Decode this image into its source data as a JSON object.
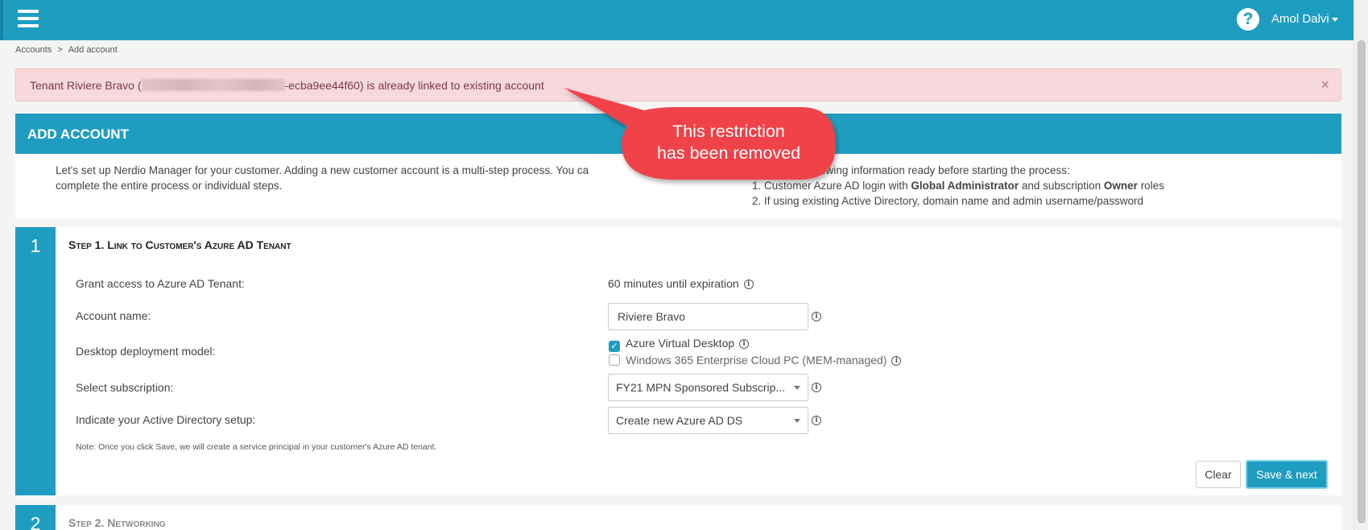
{
  "topbar": {
    "menu_icon": "hamburger-icon",
    "help_icon": "question-circle-icon",
    "help_glyph": "?",
    "user_name": "Amol Dalvi"
  },
  "breadcrumb": {
    "items": [
      "Accounts",
      "Add account"
    ],
    "separator": ">"
  },
  "alert": {
    "text_prefix": "Tenant Riviere Bravo (",
    "text_suffix": "-ecba9ee44f60) is already linked to existing account",
    "close_glyph": "×"
  },
  "card": {
    "title": "ADD ACCOUNT",
    "intro_left": "Let's set up Nerdio Manager for your customer. Adding a new customer account is a multi-step process. You ca... complete the entire process or individual steps.",
    "intro_left_line1": "Let's set up Nerdio Manager for your customer. Adding a new customer account is a multi-step process. You ca",
    "intro_left_line2": "complete the entire process or individual steps.",
    "intro_right_line1": "d have the following information ready before starting the process:",
    "intro_right_item1_prefix": "1. Customer Azure AD login with ",
    "intro_right_item1_bold1": "Global Administrator",
    "intro_right_item1_mid": " and subscription ",
    "intro_right_item1_bold2": "Owner",
    "intro_right_item1_suffix": " roles",
    "intro_right_item2": "2. If using existing Active Directory, domain name and admin username/password"
  },
  "step1": {
    "number": "1",
    "title": "Step 1. Link to Customer's Azure AD Tenant",
    "grant_label": "Grant access to Azure AD Tenant:",
    "grant_value": "60 minutes until expiration",
    "account_name_label": "Account name:",
    "account_name_value": "Riviere Bravo",
    "deployment_label": "Desktop deployment model:",
    "deployment_options": [
      {
        "label": "Azure Virtual Desktop",
        "checked": true
      },
      {
        "label": "Windows 365 Enterprise Cloud PC (MEM-managed)",
        "checked": false
      }
    ],
    "subscription_label": "Select subscription:",
    "subscription_value": "FY21 MPN Sponsored Subscrip...",
    "ad_label": "Indicate your Active Directory setup:",
    "ad_value": "Create new Azure AD DS",
    "note": "Note: Once you click Save, we will create a service principal in your customer's Azure AD tenant.",
    "clear_label": "Clear",
    "save_label": "Save & next"
  },
  "step2": {
    "number": "2",
    "title": "Step 2. Networking"
  },
  "callout": {
    "line1": "This restriction",
    "line2": "has been removed",
    "color": "#f0424a"
  },
  "colors": {
    "brand": "#1f9dc0",
    "alert_bg": "#f7d8dc",
    "callout": "#f0424a"
  }
}
